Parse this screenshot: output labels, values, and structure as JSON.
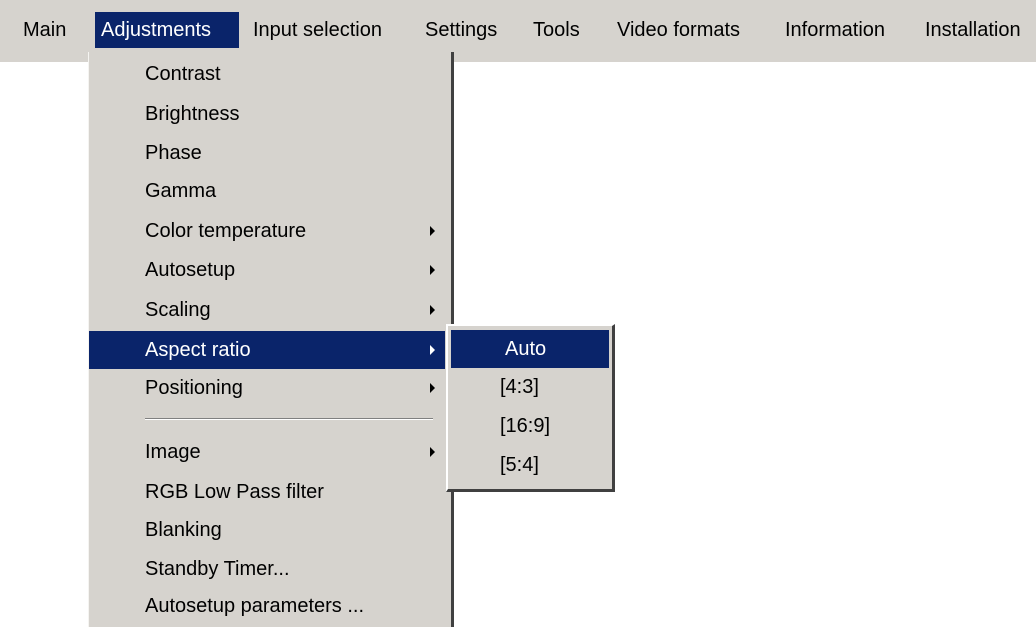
{
  "menubar": {
    "items": [
      {
        "label": "Main"
      },
      {
        "label": "Adjustments"
      },
      {
        "label": "Input selection"
      },
      {
        "label": "Settings"
      },
      {
        "label": "Tools"
      },
      {
        "label": "Video formats"
      },
      {
        "label": "Information"
      },
      {
        "label": "Installation"
      }
    ],
    "active_item": "Adjustments"
  },
  "adjustments_menu": {
    "items": [
      {
        "label": "Contrast",
        "has_submenu": false
      },
      {
        "label": "Brightness",
        "has_submenu": false
      },
      {
        "label": "Phase",
        "has_submenu": false
      },
      {
        "label": "Gamma",
        "has_submenu": false
      },
      {
        "label": "Color temperature",
        "has_submenu": true
      },
      {
        "label": "Autosetup",
        "has_submenu": true
      },
      {
        "label": "Scaling",
        "has_submenu": true
      },
      {
        "label": "Aspect ratio",
        "has_submenu": true
      },
      {
        "label": "Positioning",
        "has_submenu": true
      },
      {
        "label": "Image",
        "has_submenu": true
      },
      {
        "label": "RGB Low Pass filter",
        "has_submenu": false
      },
      {
        "label": "Blanking",
        "has_submenu": false
      },
      {
        "label": "Standby Timer...",
        "has_submenu": false
      },
      {
        "label": "Autosetup parameters ...",
        "has_submenu": false
      }
    ],
    "highlighted_item": "Aspect ratio"
  },
  "aspect_ratio_submenu": {
    "items": [
      {
        "label": "Auto"
      },
      {
        "label": "[4:3]"
      },
      {
        "label": "[16:9]"
      },
      {
        "label": "[5:4]"
      }
    ],
    "highlighted_item": "Auto"
  },
  "colors": {
    "menu_background": "#d6d3ce",
    "highlight_background": "#0a246a",
    "highlight_text": "#ffffff"
  }
}
